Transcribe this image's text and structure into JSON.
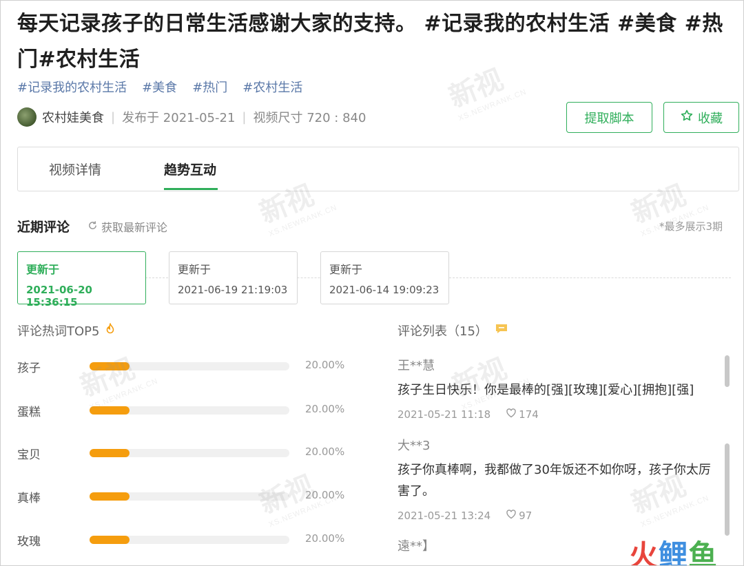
{
  "post": {
    "title": "每天记录孩子的日常生活感谢大家的支持。 #记录我的农村生活 #美食 #热门#农村生活",
    "tags": [
      "#记录我的农村生活",
      "#美食",
      "#热门",
      "#农村生活"
    ],
    "author": "农村娃美食",
    "published": "发布于 2021-05-21",
    "video_size": "视频尺寸 720 : 840"
  },
  "actions": {
    "extract_script": "提取脚本",
    "favorite": "收藏"
  },
  "tabs": [
    {
      "label": "视频详情",
      "active": false
    },
    {
      "label": "趋势互动",
      "active": true
    }
  ],
  "recent_comments": {
    "title": "近期评论",
    "refresh": "获取最新评论",
    "note": "*最多展示3期",
    "updates": [
      {
        "label": "更新于",
        "datetime": "2021-06-20 15:36:15",
        "active": true
      },
      {
        "label": "更新于",
        "datetime": "2021-06-19 21:19:03",
        "active": false
      },
      {
        "label": "更新于",
        "datetime": "2021-06-14 19:09:23",
        "active": false
      }
    ]
  },
  "keywords": {
    "title": "评论热词TOP5",
    "items": [
      {
        "word": "孩子",
        "percent": "20.00%",
        "value": 0.2
      },
      {
        "word": "蛋糕",
        "percent": "20.00%",
        "value": 0.2
      },
      {
        "word": "宝贝",
        "percent": "20.00%",
        "value": 0.2
      },
      {
        "word": "真棒",
        "percent": "20.00%",
        "value": 0.2
      },
      {
        "word": "玫瑰",
        "percent": "20.00%",
        "value": 0.2
      }
    ]
  },
  "comments": {
    "title": "评论列表（15）",
    "items": [
      {
        "user": "王**慧",
        "text": "孩子生日快乐！你是最棒的[强][玫瑰][爱心][拥抱][强]",
        "time": "2021-05-21 11:18",
        "likes": "174"
      },
      {
        "user": "大**3",
        "text": "孩子你真棒啊，我都做了30年饭还不如你呀，孩子你太厉害了。",
        "time": "2021-05-21 13:24",
        "likes": "97"
      },
      {
        "user": "遠**】",
        "text": "",
        "time": "",
        "likes": ""
      }
    ]
  },
  "watermark": {
    "big": "新视",
    "small": "XS.NEWRANK.CN"
  },
  "brand_logo": "火鲤鱼",
  "colors": {
    "accent": "#2fae5a",
    "bar": "#f59d0e",
    "tag": "#5a78a8"
  },
  "icons": [
    "refresh-icon",
    "star-icon",
    "fire-icon",
    "comment-icon",
    "heart-icon",
    "avatar"
  ]
}
